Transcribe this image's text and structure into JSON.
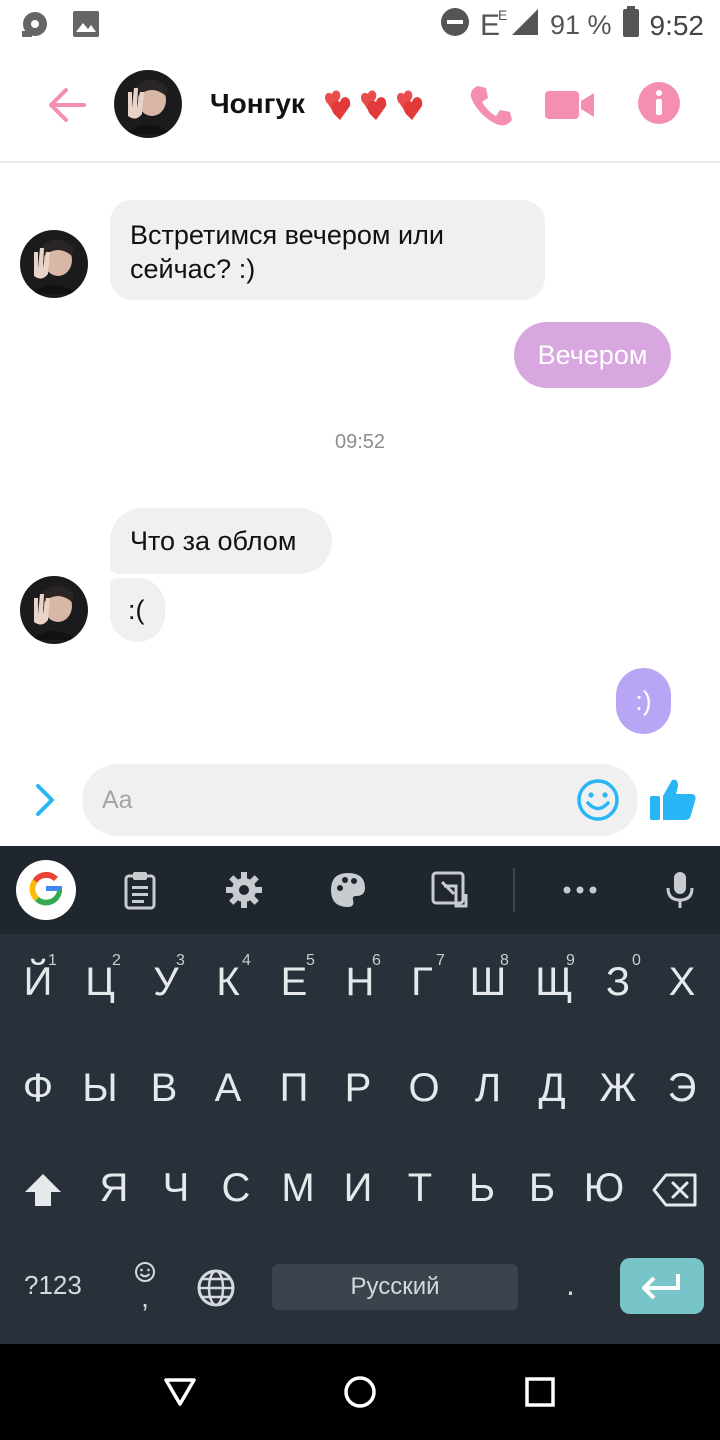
{
  "status_bar": {
    "network": "E",
    "network_super": "E",
    "battery_percent": "91 %",
    "time": "9:52"
  },
  "header": {
    "contact_name": "Чонгук",
    "hearts": [
      "💕",
      "💕",
      "💕"
    ]
  },
  "messages": [
    {
      "direction": "incoming",
      "text_line1": "Встретимся вечером или",
      "text_line2": "сейчас? :)"
    },
    {
      "direction": "outgoing",
      "text": "Вечером"
    },
    {
      "timestamp": "09:52"
    },
    {
      "direction": "incoming",
      "text": "Что за облом"
    },
    {
      "direction": "incoming",
      "text": ":("
    },
    {
      "direction": "outgoing",
      "text": ":)"
    }
  ],
  "composer": {
    "placeholder": "Aa"
  },
  "colors": {
    "accent_pink": "#f48fb1",
    "outgoing_bubble_1": "#d8a7df",
    "outgoing_bubble_2": "#b8a6f5",
    "incoming_bubble": "#f1f0f0",
    "composer_accent": "#29b6f6"
  },
  "keyboard": {
    "row1": [
      "Й",
      "Ц",
      "У",
      "К",
      "Е",
      "Н",
      "Г",
      "Ш",
      "Щ",
      "З",
      "Х"
    ],
    "row1_hints": [
      "1",
      "2",
      "3",
      "4",
      "5",
      "6",
      "7",
      "8",
      "9",
      "0"
    ],
    "row2": [
      "Ф",
      "Ы",
      "В",
      "А",
      "П",
      "Р",
      "О",
      "Л",
      "Д",
      "Ж",
      "Э"
    ],
    "row3": [
      "Я",
      "Ч",
      "С",
      "М",
      "И",
      "Т",
      "Ь",
      "Б",
      "Ю"
    ],
    "symbols_key": "?123",
    "comma_key": ",",
    "space_label": "Русский",
    "period_key": "."
  }
}
